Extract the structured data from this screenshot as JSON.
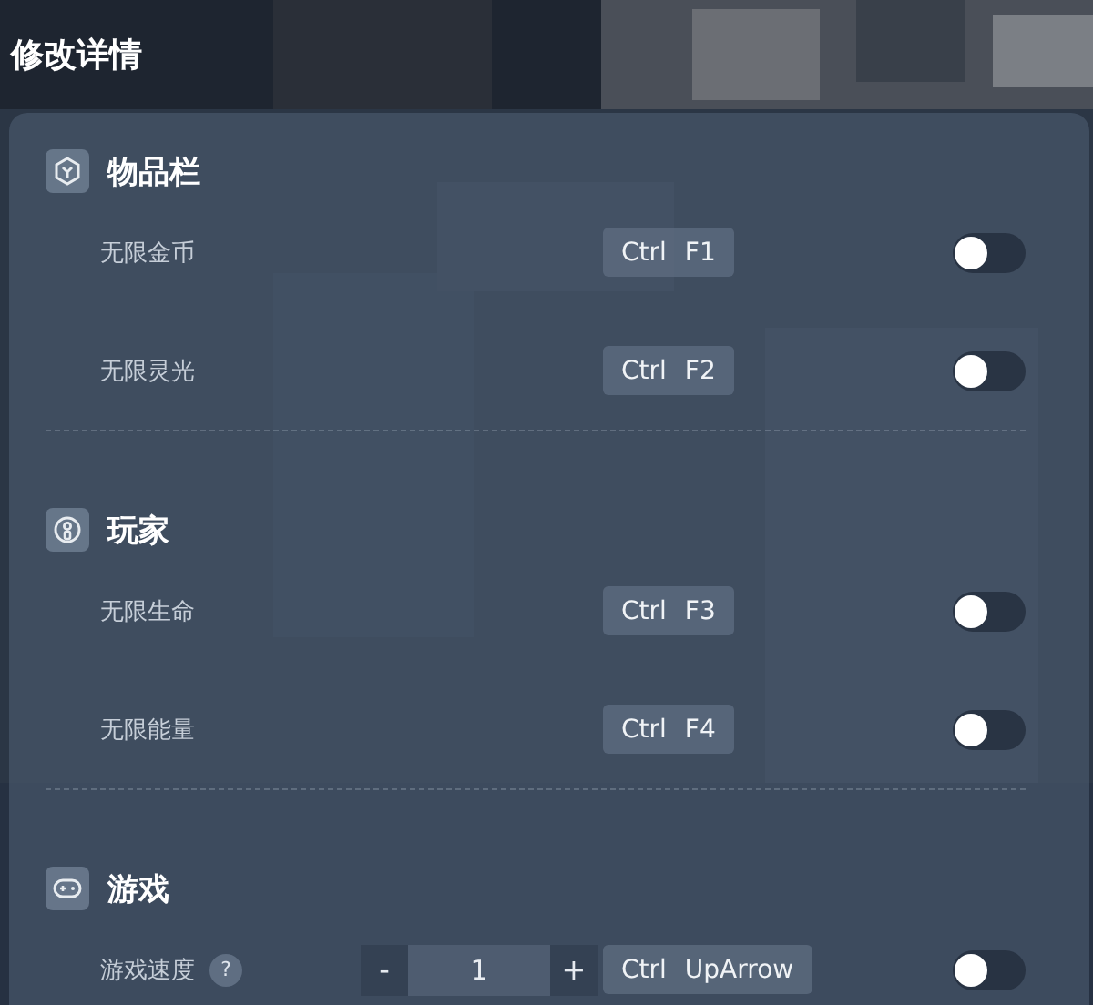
{
  "title": "修改详情",
  "sections": [
    {
      "title": "物品栏",
      "kind": "cube",
      "items": [
        {
          "kind": "toggle",
          "label": "无限金币",
          "keys": [
            "Ctrl",
            "F1"
          ],
          "on": false
        },
        {
          "kind": "toggle",
          "label": "无限灵光",
          "keys": [
            "Ctrl",
            "F2"
          ],
          "on": false
        }
      ]
    },
    {
      "title": "玩家",
      "kind": "player",
      "items": [
        {
          "kind": "toggle",
          "label": "无限生命",
          "keys": [
            "Ctrl",
            "F3"
          ],
          "on": false
        },
        {
          "kind": "toggle",
          "label": "无限能量",
          "keys": [
            "Ctrl",
            "F4"
          ],
          "on": false
        }
      ]
    },
    {
      "title": "游戏",
      "kind": "gamepad",
      "items": [
        {
          "kind": "stepper",
          "label": "游戏速度",
          "help": "?",
          "minus": "-",
          "value": "1",
          "plus": "+",
          "keys": [
            "Ctrl",
            "UpArrow"
          ],
          "on": false
        }
      ]
    }
  ]
}
